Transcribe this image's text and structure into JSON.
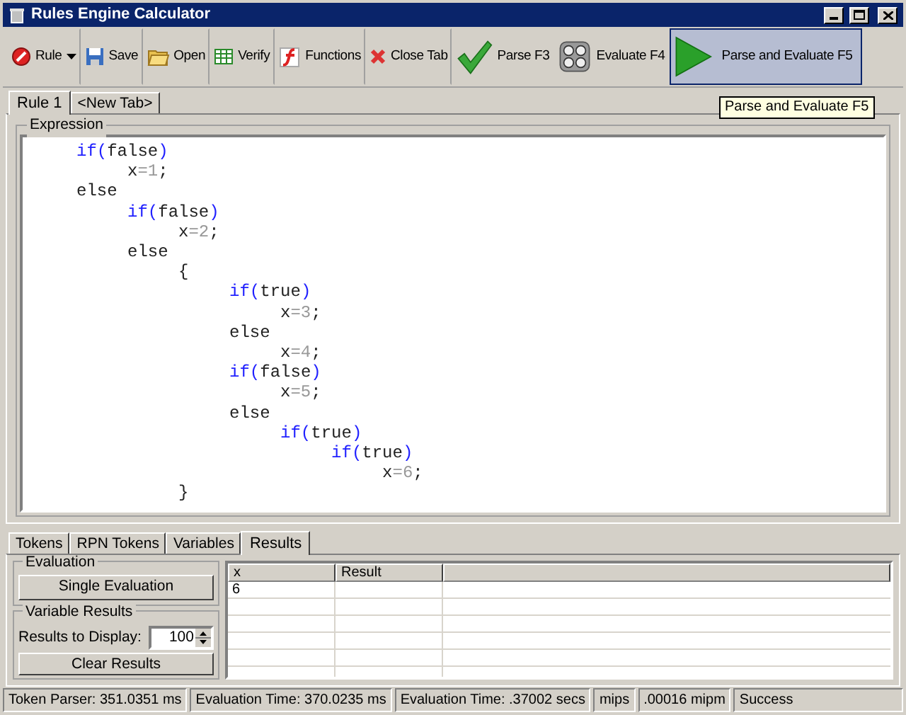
{
  "window": {
    "title": "Rules Engine Calculator"
  },
  "toolbar": [
    {
      "kind": "rule",
      "label": "Rule",
      "highlighted": false
    },
    {
      "kind": "save",
      "label": "Save",
      "highlighted": false
    },
    {
      "kind": "open",
      "label": "Open",
      "highlighted": false
    },
    {
      "kind": "verify",
      "label": "Verify",
      "highlighted": false
    },
    {
      "kind": "functions",
      "label": "Functions",
      "highlighted": false
    },
    {
      "kind": "close",
      "label": "Close Tab",
      "highlighted": false
    },
    {
      "kind": "parse",
      "label": "Parse F3",
      "highlighted": false
    },
    {
      "kind": "evaluate",
      "label": "Evaluate F4",
      "highlighted": false
    },
    {
      "kind": "parse_evaluate",
      "label": "Parse and Evaluate F5",
      "highlighted": true
    }
  ],
  "tooltip": "Parse and Evaluate F5",
  "editor_tabs": [
    {
      "label": "Rule 1",
      "selected": true
    },
    {
      "label": "<New Tab>",
      "selected": false
    }
  ],
  "expression": {
    "title": "Expression",
    "lines": [
      [
        {
          "kind": "keyword",
          "text": "     if("
        },
        {
          "kind": "plain",
          "text": "false"
        },
        {
          "kind": "keyword",
          "text": ")"
        }
      ],
      [
        {
          "kind": "plain",
          "text": "          x"
        },
        {
          "kind": "number",
          "text": "=1"
        },
        {
          "kind": "plain",
          "text": ";"
        }
      ],
      [
        {
          "kind": "plain",
          "text": "     else"
        }
      ],
      [
        {
          "kind": "keyword",
          "text": "          if("
        },
        {
          "kind": "plain",
          "text": "false"
        },
        {
          "kind": "keyword",
          "text": ")"
        }
      ],
      [
        {
          "kind": "plain",
          "text": "               x"
        },
        {
          "kind": "number",
          "text": "=2"
        },
        {
          "kind": "plain",
          "text": ";"
        }
      ],
      [
        {
          "kind": "plain",
          "text": "          else"
        }
      ],
      [
        {
          "kind": "plain",
          "text": "               {"
        }
      ],
      [
        {
          "kind": "keyword",
          "text": "                    if("
        },
        {
          "kind": "plain",
          "text": "true"
        },
        {
          "kind": "keyword",
          "text": ")"
        }
      ],
      [
        {
          "kind": "plain",
          "text": "                         x"
        },
        {
          "kind": "number",
          "text": "=3"
        },
        {
          "kind": "plain",
          "text": ";"
        }
      ],
      [
        {
          "kind": "plain",
          "text": "                    else"
        }
      ],
      [
        {
          "kind": "plain",
          "text": "                         x"
        },
        {
          "kind": "number",
          "text": "=4"
        },
        {
          "kind": "plain",
          "text": ";"
        }
      ],
      [
        {
          "kind": "keyword",
          "text": "                    if("
        },
        {
          "kind": "plain",
          "text": "false"
        },
        {
          "kind": "keyword",
          "text": ")"
        }
      ],
      [
        {
          "kind": "plain",
          "text": "                         x"
        },
        {
          "kind": "number",
          "text": "=5"
        },
        {
          "kind": "plain",
          "text": ";"
        }
      ],
      [
        {
          "kind": "plain",
          "text": "                    else"
        }
      ],
      [
        {
          "kind": "keyword",
          "text": "                         if("
        },
        {
          "kind": "plain",
          "text": "true"
        },
        {
          "kind": "keyword",
          "text": ")"
        }
      ],
      [
        {
          "kind": "keyword",
          "text": "                              if("
        },
        {
          "kind": "plain",
          "text": "true"
        },
        {
          "kind": "keyword",
          "text": ")"
        }
      ],
      [
        {
          "kind": "plain",
          "text": "                                   x"
        },
        {
          "kind": "number",
          "text": "=6"
        },
        {
          "kind": "plain",
          "text": ";"
        }
      ],
      [
        {
          "kind": "plain",
          "text": "               }"
        }
      ]
    ]
  },
  "result_tabs": [
    {
      "label": "Tokens",
      "selected": false
    },
    {
      "label": "RPN Tokens",
      "selected": false
    },
    {
      "label": "Variables",
      "selected": false
    },
    {
      "label": "Results",
      "selected": true
    }
  ],
  "evaluation": {
    "title": "Evaluation",
    "button": "Single Evaluation"
  },
  "variable_results": {
    "title": "Variable Results",
    "label": "Results to Display:",
    "value": "100",
    "button": "Clear Results"
  },
  "results_table": {
    "columns": [
      "x",
      "Result"
    ],
    "rows": [
      [
        "6",
        ""
      ]
    ]
  },
  "status_bar": [
    "Token Parser: 351.0351 ms",
    "Evaluation Time: 370.0235 ms",
    "Evaluation Time: .37002 secs",
    "mips",
    ".00016 mipm",
    "Success"
  ]
}
